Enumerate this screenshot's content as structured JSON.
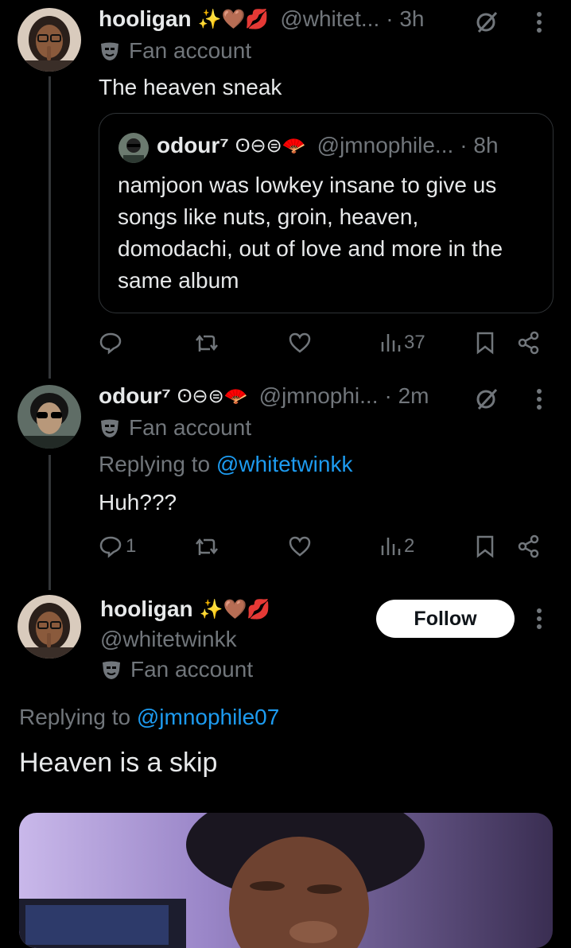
{
  "colors": {
    "background": "#000000",
    "text": "#e7e9ea",
    "muted": "#71767b",
    "link": "#1d9bf0",
    "divider": "#333639"
  },
  "tweet1": {
    "name": "hooligan",
    "name_emojis": "✨🤎💋",
    "handle": "@whitet...",
    "time": "· 3h",
    "fan_label": "Fan account",
    "text": "The heaven sneak",
    "quote": {
      "name": "odour⁷",
      "name_emojis": "ʘ⊖⊜🪭",
      "handle": "@jmnophile...",
      "time": "· 8h",
      "text": "namjoon was lowkey insane to give us songs like nuts, groin, heaven, domodachi, out of love and more in the same album"
    },
    "actions": {
      "reply": "",
      "retweet": "",
      "like": "",
      "views": "37"
    }
  },
  "tweet2": {
    "name": "odour⁷",
    "name_emojis": "ʘ⊖⊜🪭",
    "handle": "@jmnophi...",
    "time": "· 2m",
    "fan_label": "Fan account",
    "replying_prefix": "Replying to",
    "replying_to": "@whitetwinkk",
    "text": "Huh???",
    "actions": {
      "reply": "1",
      "retweet": "",
      "like": "",
      "views": "2"
    }
  },
  "tweet3": {
    "name": "hooligan",
    "name_emojis": "✨🤎💋",
    "handle": "@whitetwinkk",
    "fan_label": "Fan account",
    "follow_label": "Follow",
    "replying_prefix": "Replying to",
    "replying_to": "@jmnophile07",
    "text": "Heaven is a skip"
  },
  "icons": [
    "reply-icon",
    "retweet-icon",
    "like-icon",
    "views-icon",
    "bookmark-icon",
    "share-icon",
    "more-icon",
    "fan-mask-icon",
    "grok-icon"
  ]
}
